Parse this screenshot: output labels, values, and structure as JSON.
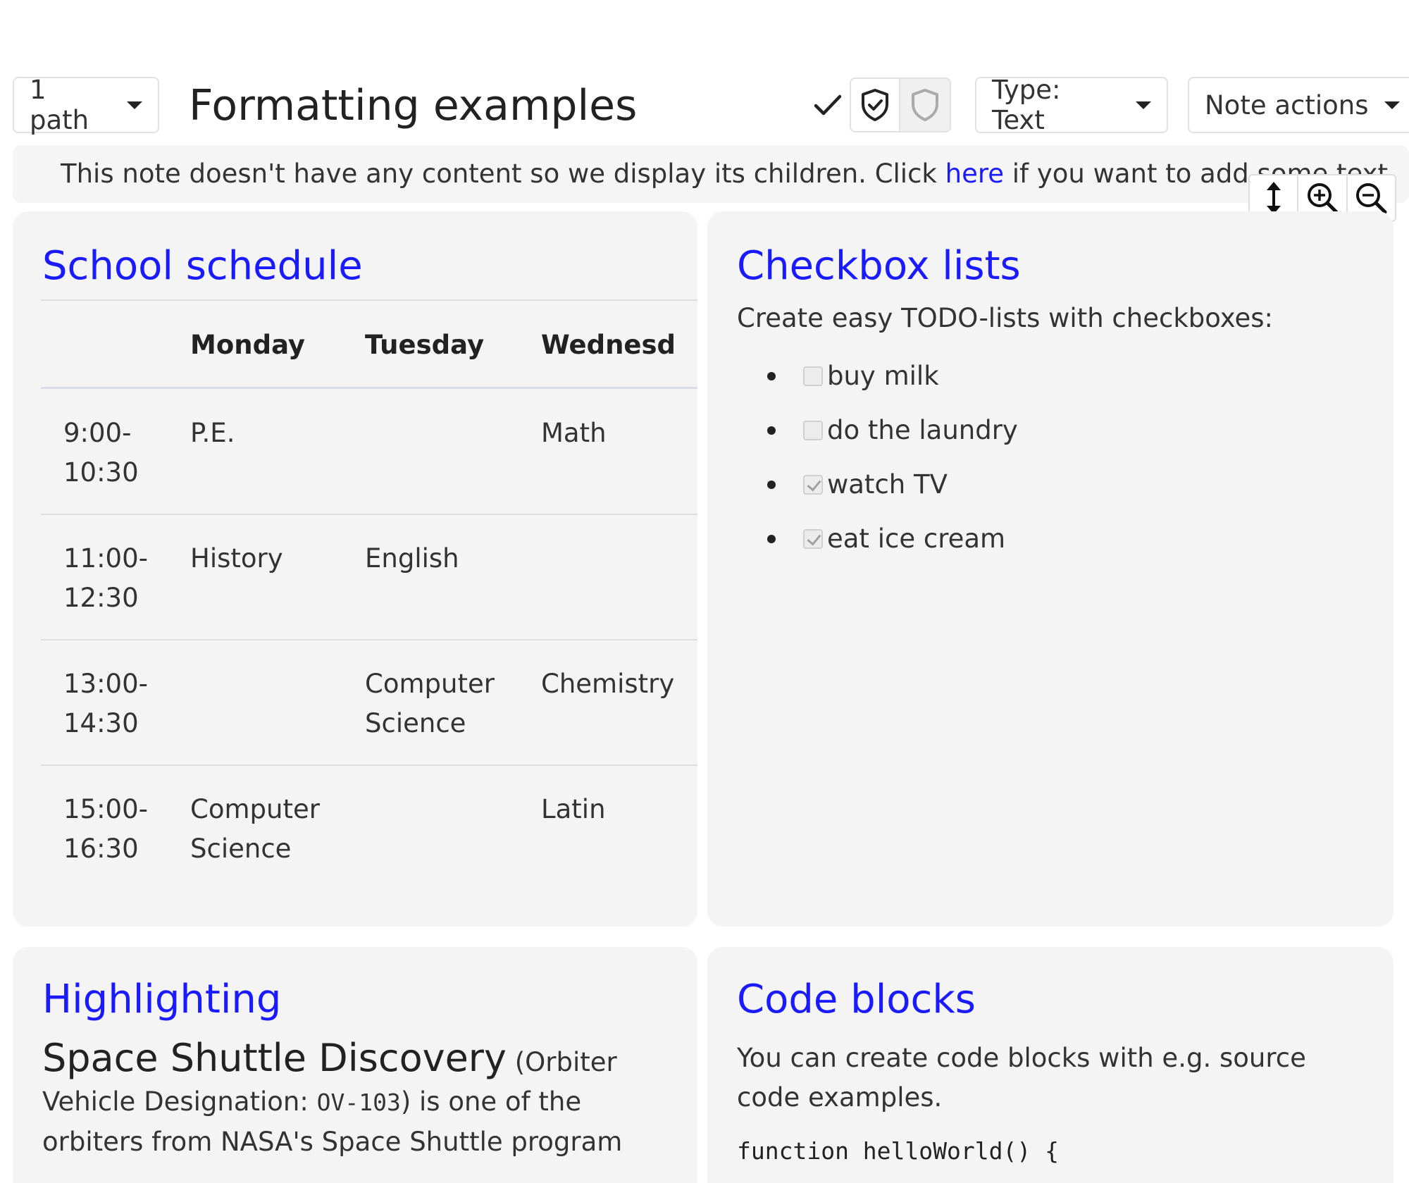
{
  "titlebar": {
    "path_label": "1 path",
    "title": "Formatting examples",
    "type_label": "Type: Text",
    "actions_label": "Note actions"
  },
  "info": {
    "prefix": "This note doesn't have any content so we display its children. Click ",
    "link": "here",
    "suffix": " if you want to add some text."
  },
  "schedule": {
    "title": "School schedule",
    "headers": [
      "Monday",
      "Tuesday",
      "Wednesd"
    ],
    "rows": [
      {
        "time": [
          "9:00-",
          "10:30"
        ],
        "monday": [
          "P.E."
        ],
        "tuesday": [],
        "wednesday": [
          "Math"
        ]
      },
      {
        "time": [
          "11:00-",
          "12:30"
        ],
        "monday": [
          "History"
        ],
        "tuesday": [
          "English"
        ],
        "wednesday": []
      },
      {
        "time": [
          "13:00-",
          "14:30"
        ],
        "monday": [],
        "tuesday": [
          "Computer",
          "Science"
        ],
        "wednesday": [
          "Chemistry"
        ]
      },
      {
        "time": [
          "15:00-",
          "16:30"
        ],
        "monday": [
          "Computer",
          "Science"
        ],
        "tuesday": [],
        "wednesday": [
          "Latin"
        ]
      }
    ]
  },
  "checkbox": {
    "title": "Checkbox lists",
    "intro": "Create easy TODO-lists with checkboxes:",
    "items": [
      {
        "label": "buy milk",
        "checked": false
      },
      {
        "label": "do the laundry",
        "checked": false
      },
      {
        "label": "watch TV",
        "checked": true
      },
      {
        "label": "eat ice cream",
        "checked": true
      }
    ]
  },
  "highlight": {
    "title": "Highlighting",
    "big": "Space Shuttle Discovery",
    "paren": " (Orbiter",
    "line2_a": "Vehicle Designation: ",
    "mono": "OV-103",
    "line2_b": ") is one of the",
    "line3": "orbiters from NASA's Space Shuttle program"
  },
  "code": {
    "title": "Code blocks",
    "intro": "You can create code blocks with e.g. source code examples.",
    "line1": "function helloWorld() {"
  }
}
